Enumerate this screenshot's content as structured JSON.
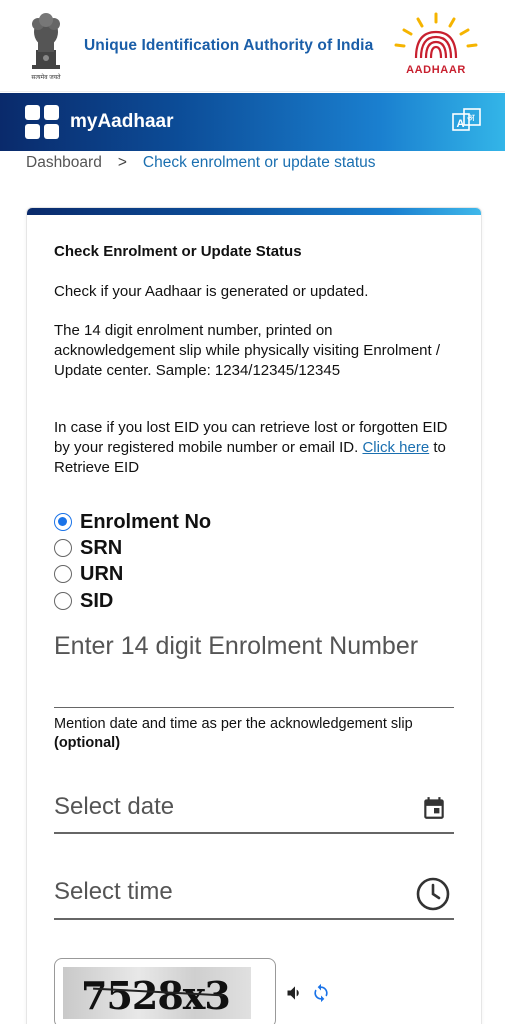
{
  "header": {
    "emblem_caption": "सत्यमेव जयते",
    "org_name": "Unique Identification Authority of India",
    "logo_text": "AADHAAR"
  },
  "navbar": {
    "title": "myAadhaar",
    "menu_icon": "grid-icon",
    "language_icon": "translate-icon"
  },
  "breadcrumb": {
    "home": "Dashboard",
    "separator": ">",
    "current": "Check enrolment or update status"
  },
  "card": {
    "title": "Check Enrolment or Update Status",
    "intro": "Check if your Aadhaar is generated or updated.",
    "enrolment_info": "The 14 digit enrolment number, printed on acknowledgement slip while physically visiting Enrolment / Update center. Sample: 1234/12345/12345",
    "lost_eid_text": "In case if you lost EID you can retrieve lost or forgotten EID by your registered mobile number or email ID.",
    "lost_eid_link": "Click here",
    "lost_eid_suffix": "to Retrieve EID",
    "radio_options": [
      {
        "label": "Enrolment No",
        "checked": true
      },
      {
        "label": "SRN",
        "checked": false
      },
      {
        "label": "URN",
        "checked": false
      },
      {
        "label": "SID",
        "checked": false
      }
    ],
    "enrolment_field_placeholder": "Enter 14 digit Enrolment Number",
    "date_helper_text": "Mention date and time as per the acknowledgement slip",
    "date_helper_optional": "(optional)",
    "date_placeholder": "Select date",
    "time_placeholder": "Select time",
    "captcha_text": "7528x3"
  },
  "colors": {
    "brand_blue": "#1a6fb0",
    "radio_accent": "#1a73e8",
    "logo_red": "#c8202f"
  }
}
